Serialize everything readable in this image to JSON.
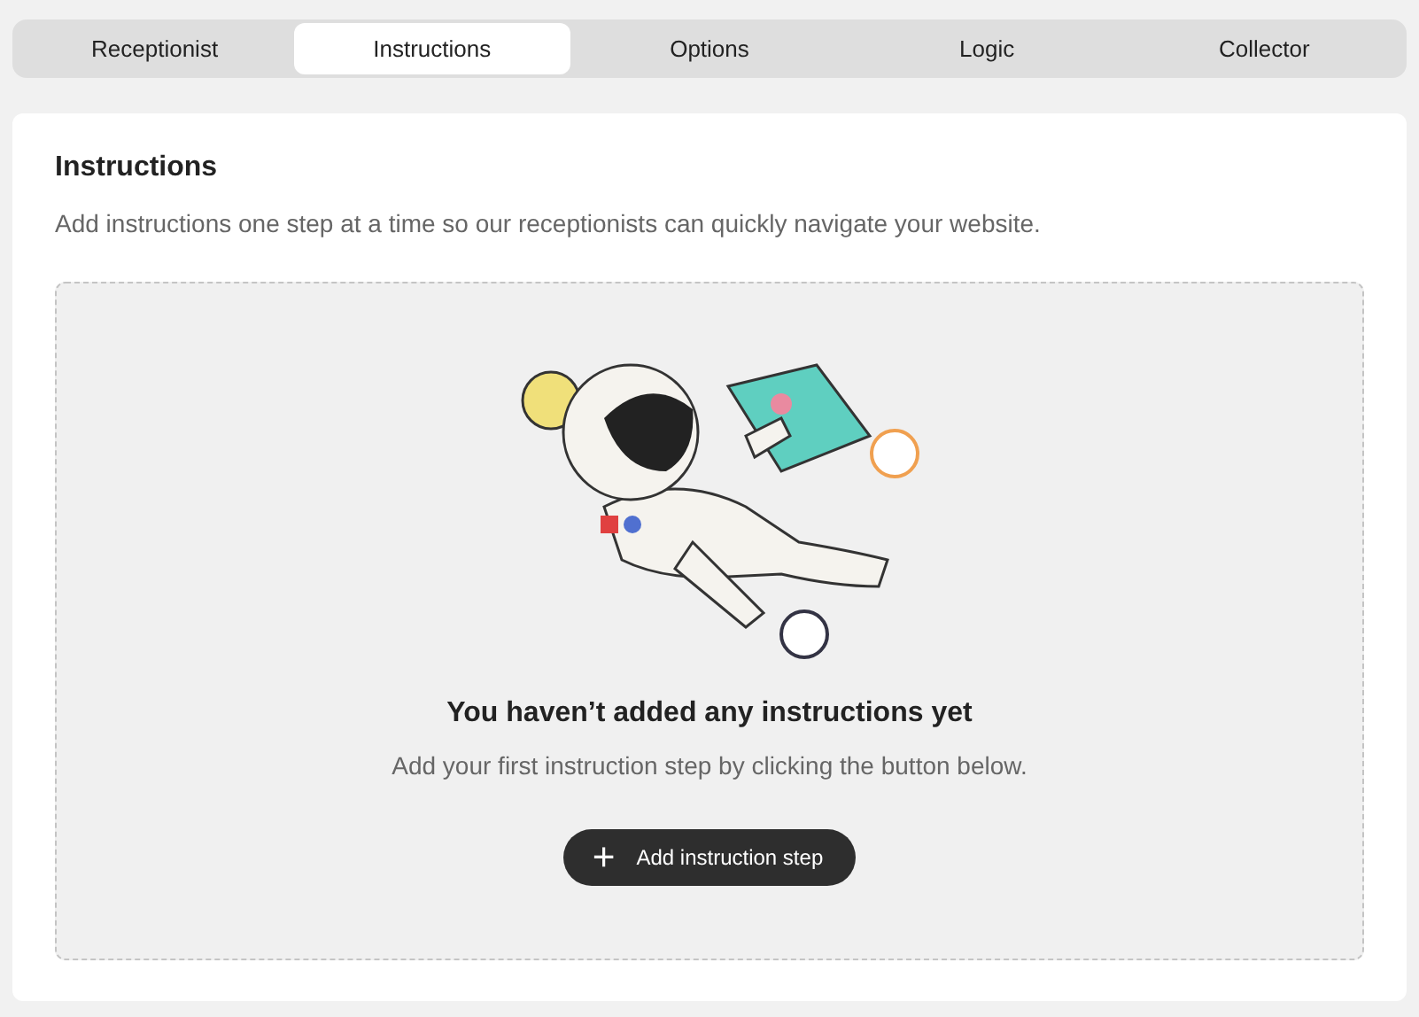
{
  "tabs": [
    {
      "label": "Receptionist",
      "selected": false
    },
    {
      "label": "Instructions",
      "selected": true
    },
    {
      "label": "Options",
      "selected": false
    },
    {
      "label": "Logic",
      "selected": false
    },
    {
      "label": "Collector",
      "selected": false
    }
  ],
  "section": {
    "title": "Instructions",
    "description": "Add instructions one step at a time so our receptionists can quickly navigate your website."
  },
  "empty_state": {
    "title": "You haven’t added any instructions yet",
    "message": "Add your first instruction step by clicking the button below.",
    "button": {
      "icon": "+",
      "label": "Add instruction step"
    }
  }
}
